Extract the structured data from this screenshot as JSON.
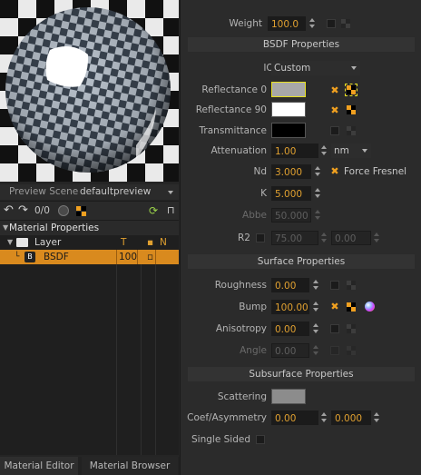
{
  "preview": {
    "scene_label": "Preview Scene",
    "scene_value": "defaultpreview"
  },
  "toolbar": {
    "counter": "0/0"
  },
  "tree": {
    "root_label": "Material Properties",
    "layer_label": "Layer",
    "col_t": "T",
    "col_dot": "▪",
    "col_n": "N",
    "bsdf_badge": "B",
    "bsdf_label": "BSDF",
    "bsdf_t_value": "100",
    "bsdf_dot": "▫"
  },
  "tabs": {
    "material_editor": "Material Editor",
    "material_browser": "Material Browser"
  },
  "props": {
    "weight_label": "Weight",
    "weight_value": "100.0",
    "bsdf_header": "BSDF Properties",
    "ior_label": "IOR",
    "ior_value": "Custom",
    "reflectance0_label": "Reflectance 0",
    "reflectance90_label": "Reflectance 90",
    "transmittance_label": "Transmittance",
    "attenuation_label": "Attenuation",
    "attenuation_value": "1.00",
    "attenuation_unit": "nm",
    "nd_label": "Nd",
    "nd_value": "3.000",
    "force_fresnel_label": "Force Fresnel",
    "k_label": "K",
    "k_value": "5.000",
    "abbe_label": "Abbe",
    "abbe_value": "50.000",
    "r2_label": "R2",
    "r2_value_a": "75.00",
    "r2_value_b": "0.00",
    "surface_header": "Surface Properties",
    "roughness_label": "Roughness",
    "roughness_value": "0.00",
    "bump_label": "Bump",
    "bump_value": "100.00",
    "anisotropy_label": "Anisotropy",
    "anisotropy_value": "0.00",
    "angle_label": "Angle",
    "angle_value": "0.00",
    "subsurface_header": "Subsurface Properties",
    "scattering_label": "Scattering",
    "coef_label": "Coef/Asymmetry",
    "coef_value": "0.00",
    "asym_value": "0.000",
    "single_sided_label": "Single Sided"
  },
  "colors": {
    "accent": "#f0a020",
    "reflectance0_swatch": "#a8a8a8",
    "reflectance90_swatch": "#ffffff",
    "transmittance_swatch": "#000000",
    "scattering_swatch": "#8c8c8c",
    "layer_row_highlight": "#d98a1e"
  }
}
